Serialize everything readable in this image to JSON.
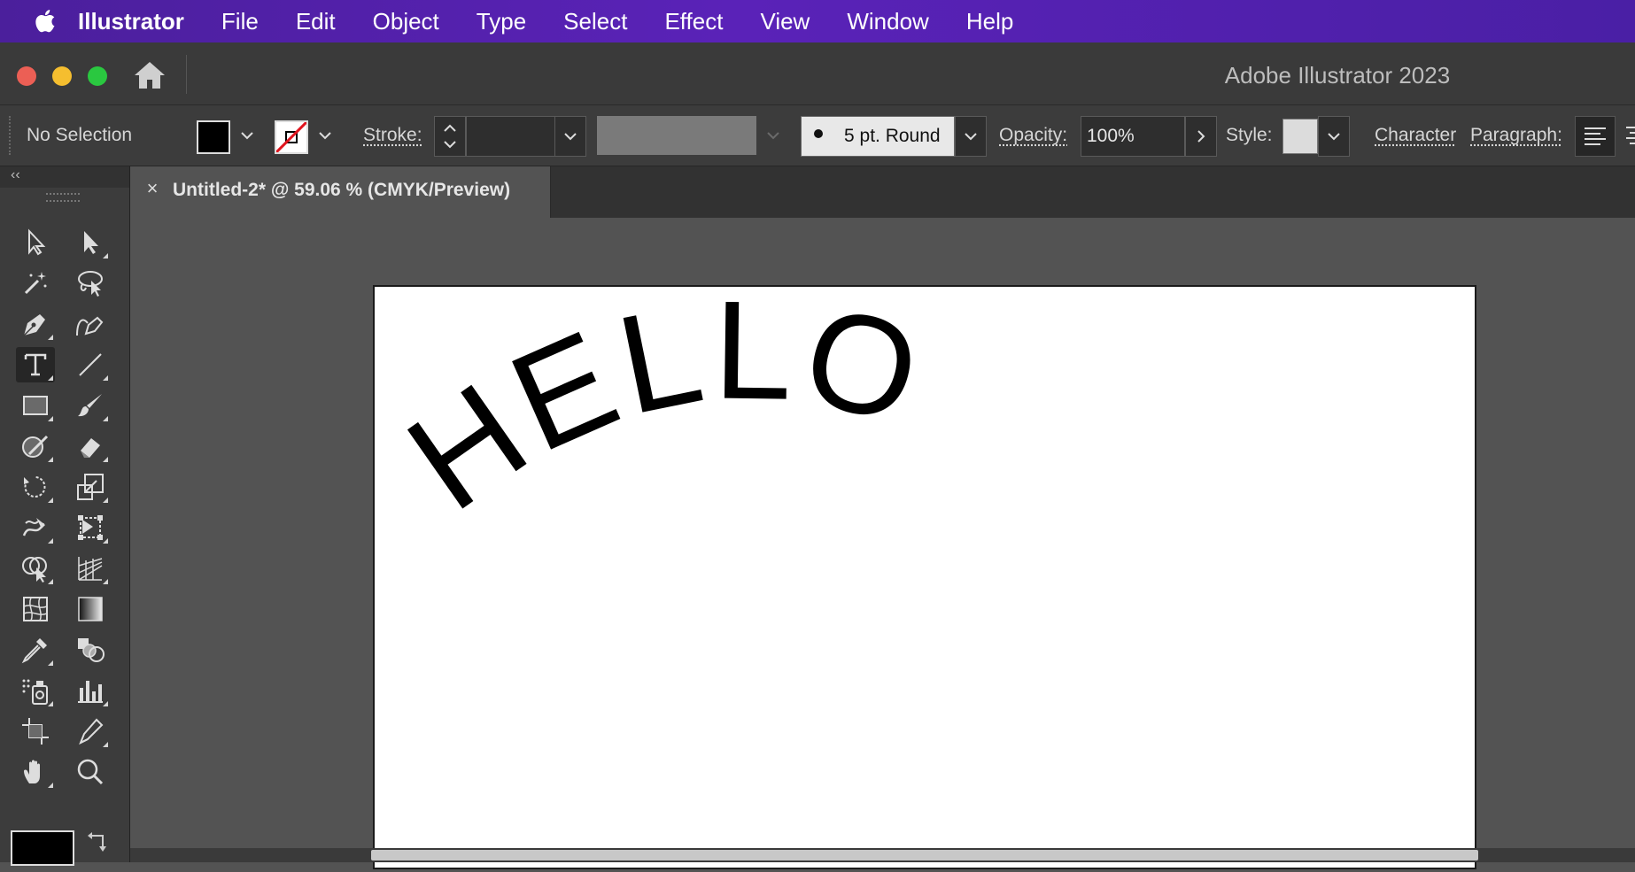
{
  "menubar": {
    "app_name": "Illustrator",
    "items": [
      "File",
      "Edit",
      "Object",
      "Type",
      "Select",
      "Effect",
      "View",
      "Window",
      "Help"
    ]
  },
  "window": {
    "title": "Adobe Illustrator 2023"
  },
  "controlbar": {
    "selection_label": "No Selection",
    "stroke_label": "Stroke:",
    "brush_label": "5 pt. Round",
    "opacity_label": "Opacity:",
    "opacity_value": "100%",
    "style_label": "Style:",
    "character_link": "Character",
    "paragraph_link": "Paragraph:"
  },
  "document": {
    "tab_label": "Untitled-2* @ 59.06 % (CMYK/Preview)",
    "close_icon_glyph": "×",
    "artwork_text": "HELLO"
  },
  "tools": [
    "selection-tool-icon",
    "direct-selection-tool-icon",
    "magic-wand-tool-icon",
    "lasso-tool-icon",
    "pen-tool-icon",
    "curvature-tool-icon",
    "type-tool-icon",
    "line-segment-tool-icon",
    "rectangle-tool-icon",
    "paintbrush-tool-icon",
    "shaper-tool-icon",
    "eraser-tool-icon",
    "rotate-tool-icon",
    "scale-tool-icon",
    "warp-tool-icon",
    "free-transform-tool-icon",
    "shape-builder-tool-icon",
    "perspective-grid-tool-icon",
    "mesh-tool-icon",
    "gradient-tool-icon",
    "eyedropper-tool-icon",
    "blend-tool-icon",
    "symbol-sprayer-tool-icon",
    "column-graph-tool-icon",
    "artboard-tool-icon",
    "slice-tool-icon",
    "hand-tool-icon",
    "zoom-tool-icon"
  ],
  "colors": {
    "menubar": "#4b1f9c",
    "fill": "#000000",
    "stroke_none_slash": "#e0141e",
    "close_red": "#ec5f55",
    "minimize_yellow": "#f5be2f",
    "zoom_green": "#2ac840"
  }
}
